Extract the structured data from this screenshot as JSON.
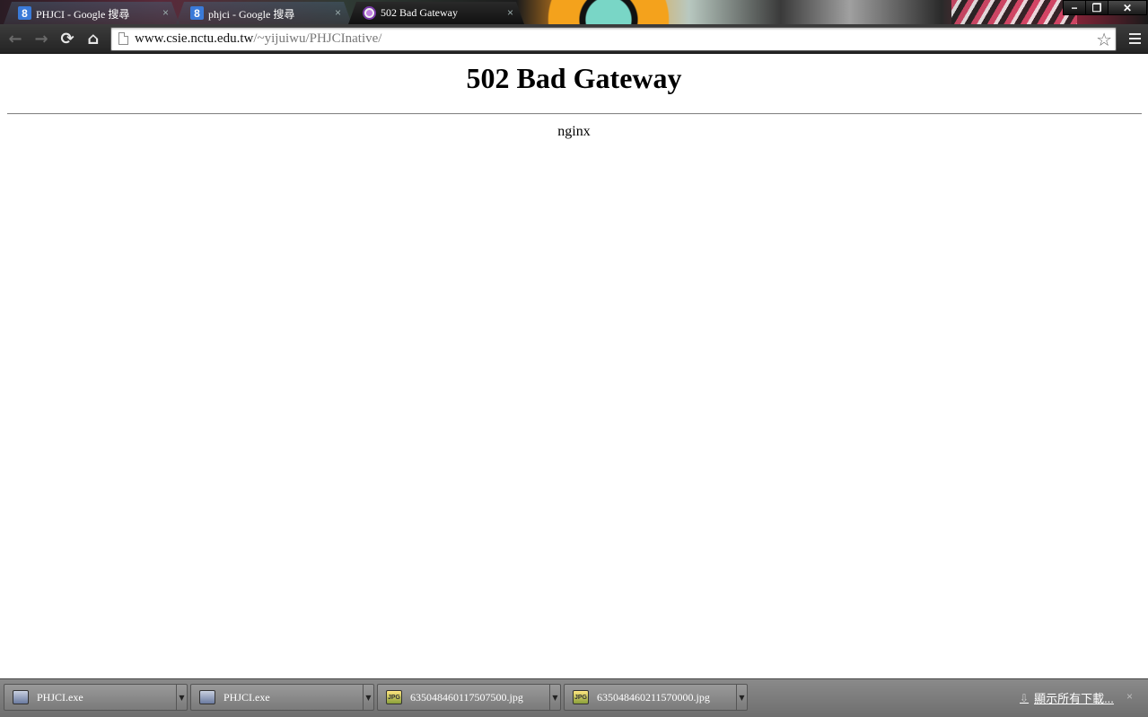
{
  "tabs": [
    {
      "label": "PHJCI - Google 搜尋",
      "favicon": "google-icon",
      "favicon_glyph": "8",
      "state": "inactive"
    },
    {
      "label": "phjci - Google 搜尋",
      "favicon": "google-icon",
      "favicon_glyph": "8",
      "state": "inactive"
    },
    {
      "label": "502 Bad Gateway",
      "favicon": "error-page-icon",
      "state": "active"
    }
  ],
  "tab_close_glyph": "×",
  "window_controls": {
    "minimize": "−",
    "maximize": "❐",
    "close": "✕"
  },
  "toolbar": {
    "back_glyph": "←",
    "forward_glyph": "→",
    "reload_glyph": "⟳",
    "home_glyph": "⌂",
    "url_host": "www.csie.nctu.edu.tw",
    "url_path": "/~yijuiwu/PHJCInative/",
    "star_glyph": "☆"
  },
  "page": {
    "heading": "502 Bad Gateway",
    "server": "nginx"
  },
  "downloads": {
    "items": [
      {
        "name": "PHJCI.exe",
        "type": "exe"
      },
      {
        "name": "PHJCI.exe",
        "type": "exe"
      },
      {
        "name": "635048460117507500.jpg",
        "type": "jpg"
      },
      {
        "name": "635048460211570000.jpg",
        "type": "jpg"
      }
    ],
    "jpg_badge": "JPG",
    "arrow_glyph": "▼",
    "show_all": "顯示所有下載...",
    "down_glyph": "⇩",
    "close_glyph": "×"
  }
}
